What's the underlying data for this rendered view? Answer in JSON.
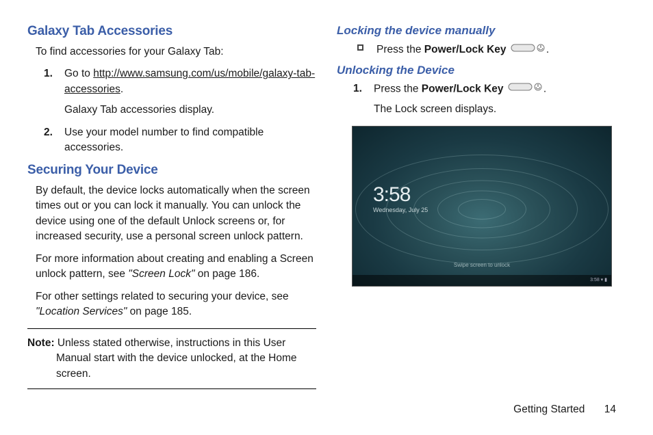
{
  "left": {
    "h1a": "Galaxy Tab Accessories",
    "intro": "To find accessories for your Galaxy Tab:",
    "step1_num": "1.",
    "step1_pre": "Go to ",
    "step1_link": "http://www.samsung.com/us/mobile/galaxy-tab-accessories",
    "step1_post": ".",
    "step1_sub": "Galaxy Tab accessories display.",
    "step2_num": "2.",
    "step2": "Use your model number to find compatible accessories.",
    "h1b": "Securing Your Device",
    "sec_p1": "By default, the device locks automatically when the screen times out or you can lock it manually. You can unlock the device using one of the default Unlock screens or, for increased security, use a personal screen unlock pattern.",
    "sec_p2_pre": "For more information about creating and enabling a Screen unlock pattern, see ",
    "sec_p2_ref": "\"Screen Lock\"",
    "sec_p2_post": " on page 186.",
    "sec_p3_pre": "For other settings related to securing your device, see ",
    "sec_p3_ref": "\"Location Services\"",
    "sec_p3_post": " on page 185.",
    "note_label": "Note:",
    "note_body": " Unless stated otherwise, instructions in this User Manual start with the device unlocked, at the Home screen."
  },
  "right": {
    "h2a": "Locking the device manually",
    "bullet1_pre": "Press the ",
    "bullet1_key": "Power/Lock Key",
    "bullet1_post": ".",
    "h2b": "Unlocking the Device",
    "step1_num": "1.",
    "step1_pre": "Press the ",
    "step1_key": "Power/Lock Key",
    "step1_post": ".",
    "step1_sub": "The Lock screen displays.",
    "lock_time": "3:58",
    "lock_date": "Wednesday, July 25",
    "swipe": "Swipe screen to unlock",
    "status": "3:58"
  },
  "footer": {
    "section": "Getting Started",
    "page": "14"
  }
}
